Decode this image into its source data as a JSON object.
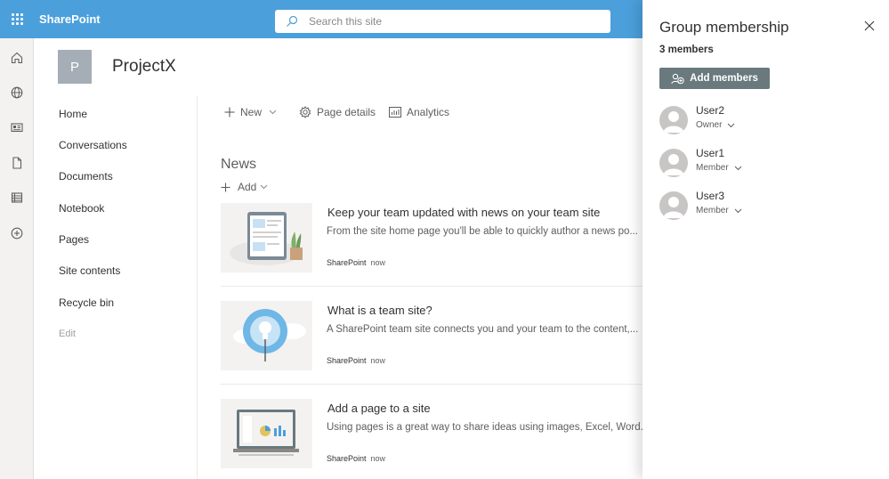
{
  "suite": {
    "app_name": "SharePoint",
    "search_placeholder": "Search this site"
  },
  "appbar": {
    "icons": [
      "home-icon",
      "globe-icon",
      "news-icon",
      "file-icon",
      "list-icon",
      "add-icon"
    ]
  },
  "site": {
    "logo_letter": "P",
    "title": "ProjectX"
  },
  "nav": {
    "items": [
      {
        "label": "Home"
      },
      {
        "label": "Conversations"
      },
      {
        "label": "Documents"
      },
      {
        "label": "Notebook"
      },
      {
        "label": "Pages"
      },
      {
        "label": "Site contents"
      },
      {
        "label": "Recycle bin"
      },
      {
        "label": "Edit"
      }
    ]
  },
  "commandbar": {
    "new_label": "New",
    "page_details_label": "Page details",
    "analytics_label": "Analytics"
  },
  "news": {
    "title": "News",
    "add_label": "Add",
    "items": [
      {
        "headline": "Keep your team updated with news on your team site",
        "description": "From the site home page you'll be able to quickly author a news po...",
        "source": "SharePoint",
        "time": "now"
      },
      {
        "headline": "What is a team site?",
        "description": "A SharePoint team site connects you and your team to the content,...",
        "source": "SharePoint",
        "time": "now"
      },
      {
        "headline": "Add a page to a site",
        "description": "Using pages is a great way to share ideas using images, Excel, Word...",
        "source": "SharePoint",
        "time": "now"
      }
    ]
  },
  "panel": {
    "title": "Group membership",
    "member_count": "3 members",
    "add_button_label": "Add members",
    "members": [
      {
        "name": "User2",
        "role": "Owner"
      },
      {
        "name": "User1",
        "role": "Member"
      },
      {
        "name": "User3",
        "role": "Member"
      }
    ]
  },
  "colors": {
    "suite_bar": "#4b9fdb",
    "add_button": "#69797e",
    "avatar": "#c8c6c4"
  }
}
